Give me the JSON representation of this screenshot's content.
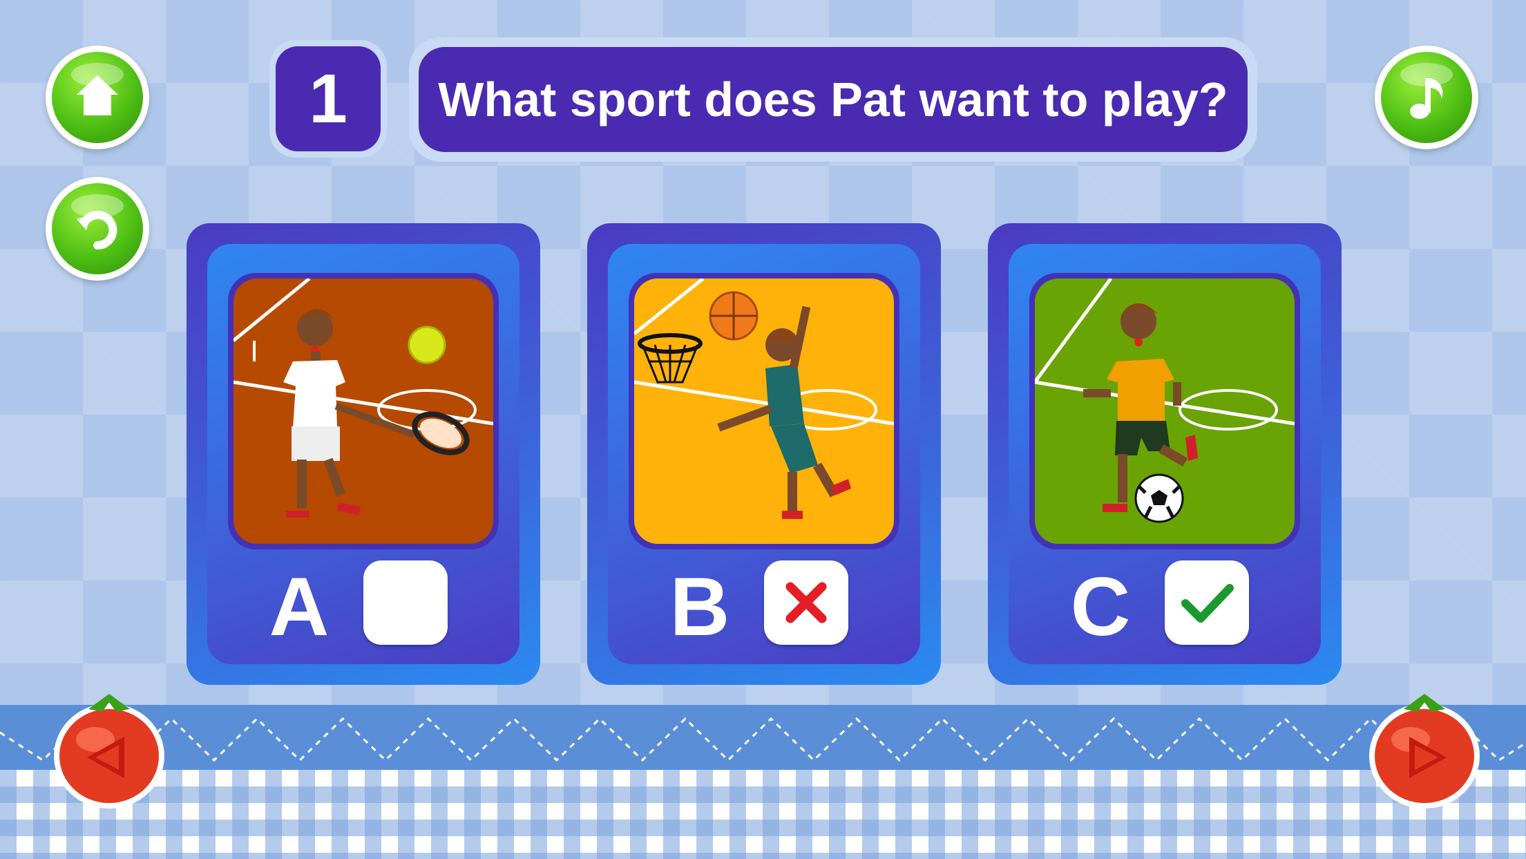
{
  "header": {
    "question_number": "1",
    "question_text": "What sport does Pat want to play?"
  },
  "buttons": {
    "home": "home-icon",
    "replay": "replay-icon",
    "music": "music-note-icon",
    "previous": "previous-arrow-icon",
    "next": "next-arrow-icon"
  },
  "options": [
    {
      "letter": "A",
      "sport": "tennis",
      "state": "unchecked"
    },
    {
      "letter": "B",
      "sport": "basketball",
      "state": "wrong"
    },
    {
      "letter": "C",
      "sport": "soccer",
      "state": "correct"
    }
  ],
  "colors": {
    "accent_purple": "#4a2ab0",
    "button_green": "#4fbf14",
    "tennis_court": "#b64a00",
    "basketball_court": "#ffb20a",
    "soccer_field": "#6aa304",
    "wrong_mark": "#e31e24",
    "correct_mark": "#1a9a2e"
  }
}
